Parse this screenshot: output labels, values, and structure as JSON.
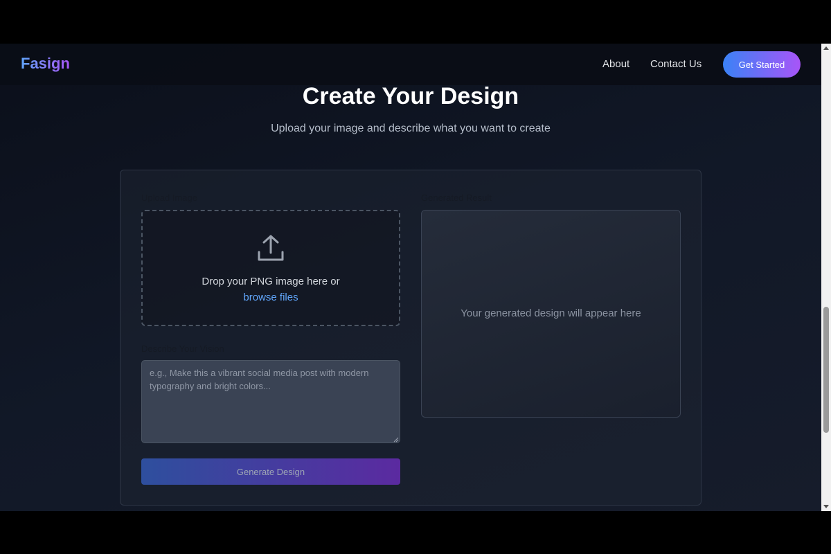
{
  "nav": {
    "logo": "Fasign",
    "links": [
      "About",
      "Contact Us"
    ],
    "cta": "Get Started"
  },
  "hero": {
    "title": "Create Your Design",
    "subtitle": "Upload your image and describe what you want to create"
  },
  "upload": {
    "label": "Upload Image",
    "drop_text": "Drop your PNG image here or",
    "browse_text": "browse files",
    "icon": "upload-icon"
  },
  "vision": {
    "label": "Describe Your Vision",
    "placeholder": "e.g., Make this a vibrant social media post with modern typography and bright colors..."
  },
  "generate_button": "Generate Design",
  "result": {
    "label": "Generated Result",
    "placeholder": "Your generated design will appear here"
  },
  "colors": {
    "accent_start": "#3b82f6",
    "accent_end": "#a855f7",
    "link": "#60a5fa",
    "background": "#111827"
  }
}
